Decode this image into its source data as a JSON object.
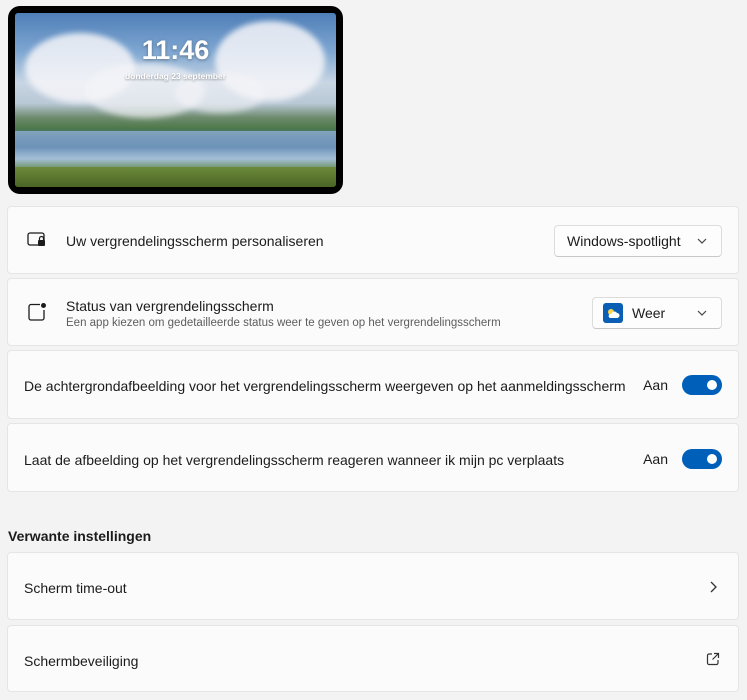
{
  "preview": {
    "time": "11:46",
    "date": "donderdag 23 september"
  },
  "settings": {
    "personalize": {
      "label": "Uw vergrendelingsscherm personaliseren",
      "value": "Windows-spotlight",
      "icon": "lockscreen-icon"
    },
    "status": {
      "label": "Status van vergrendelingsscherm",
      "description": "Een app kiezen om gedetailleerde status weer te geven op het vergrendelingsscherm",
      "value": "Weer",
      "icon": "status-icon",
      "app_icon": "weather-app-icon",
      "app_color": "#0a5fb4"
    },
    "show_background": {
      "label": "De achtergrondafbeelding voor het vergrendelingsscherm weergeven op het aanmeldingsscherm",
      "state": "Aan"
    },
    "motion": {
      "label": "Laat de afbeelding op het vergrendelingsscherm reageren wanneer ik mijn pc verplaats",
      "state": "Aan"
    }
  },
  "related": {
    "title": "Verwante instellingen",
    "items": [
      {
        "label": "Scherm time-out",
        "icon": "chevron-right-icon"
      },
      {
        "label": "Schermbeveiliging",
        "icon": "external-link-icon"
      }
    ]
  },
  "colors": {
    "accent": "#005fb8",
    "background": "#f3f3f3",
    "card": "#fbfbfb"
  }
}
